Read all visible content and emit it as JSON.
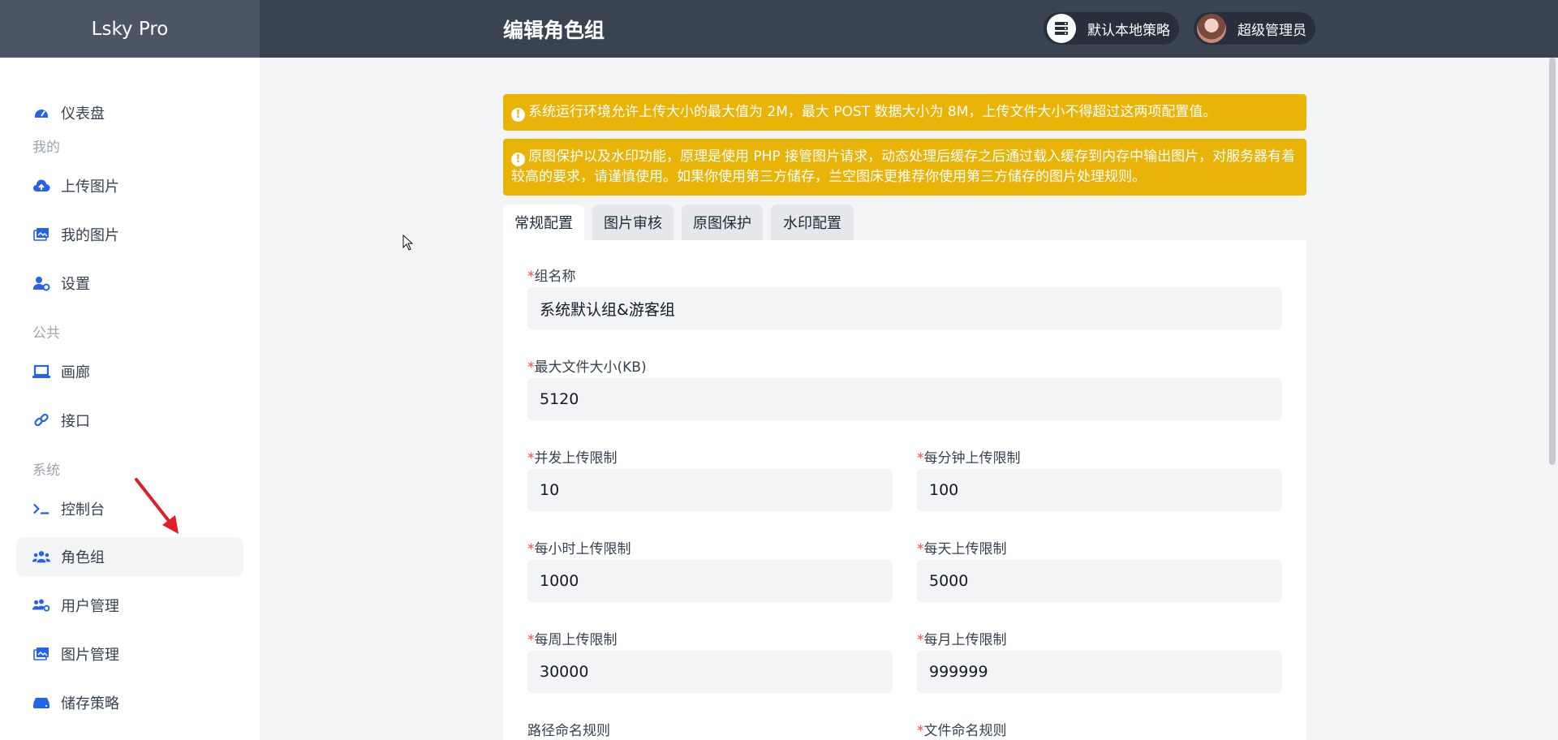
{
  "header": {
    "brand": "Lsky Pro",
    "title": "编辑角色组",
    "strategy": "默认本地策略",
    "user": "超级管理员"
  },
  "sidebar": {
    "items": [
      {
        "label": "仪表盘",
        "icon": "dashboard-icon"
      },
      {
        "label": "上传图片",
        "icon": "cloud-upload-icon"
      },
      {
        "label": "我的图片",
        "icon": "images-icon"
      },
      {
        "label": "设置",
        "icon": "user-gear-icon"
      },
      {
        "label": "画廊",
        "icon": "laptop-icon"
      },
      {
        "label": "接口",
        "icon": "link-icon"
      },
      {
        "label": "控制台",
        "icon": "terminal-icon"
      },
      {
        "label": "角色组",
        "icon": "users-icon"
      },
      {
        "label": "用户管理",
        "icon": "users-gear-icon"
      },
      {
        "label": "图片管理",
        "icon": "images-icon"
      },
      {
        "label": "储存策略",
        "icon": "hdd-icon"
      }
    ],
    "sections": [
      "我的",
      "公共",
      "系统"
    ],
    "active": "角色组"
  },
  "alerts": [
    "系统运行环境允许上传大小的最大值为 2M，最大 POST 数据大小为 8M，上传文件大小不得超过这两项配置值。",
    "原图保护以及水印功能，原理是使用 PHP 接管图片请求，动态处理后缓存之后通过载入缓存到内存中输出图片，对服务器有着较高的要求，请谨慎使用。如果你使用第三方储存，兰空图床更推荐你使用第三方储存的图片处理规则。"
  ],
  "tabs": [
    "常规配置",
    "图片审核",
    "原图保护",
    "水印配置"
  ],
  "active_tab": "常规配置",
  "form": {
    "name_label": "组名称",
    "name_value": "系统默认组&游客组",
    "max_size_label": "最大文件大小(KB)",
    "max_size_value": "5120",
    "concurrent_label": "并发上传限制",
    "concurrent_value": "10",
    "per_minute_label": "每分钟上传限制",
    "per_minute_value": "100",
    "per_hour_label": "每小时上传限制",
    "per_hour_value": "1000",
    "per_day_label": "每天上传限制",
    "per_day_value": "5000",
    "per_week_label": "每周上传限制",
    "per_week_value": "30000",
    "per_month_label": "每月上传限制",
    "per_month_value": "999999",
    "path_rule_label": "路径命名规则",
    "file_rule_label": "文件命名规则",
    "required_mark": "*"
  },
  "colors": {
    "accent": "#2563eb",
    "warning": "#eab308",
    "header": "#3a4451",
    "brand_bg": "#4b5563"
  }
}
